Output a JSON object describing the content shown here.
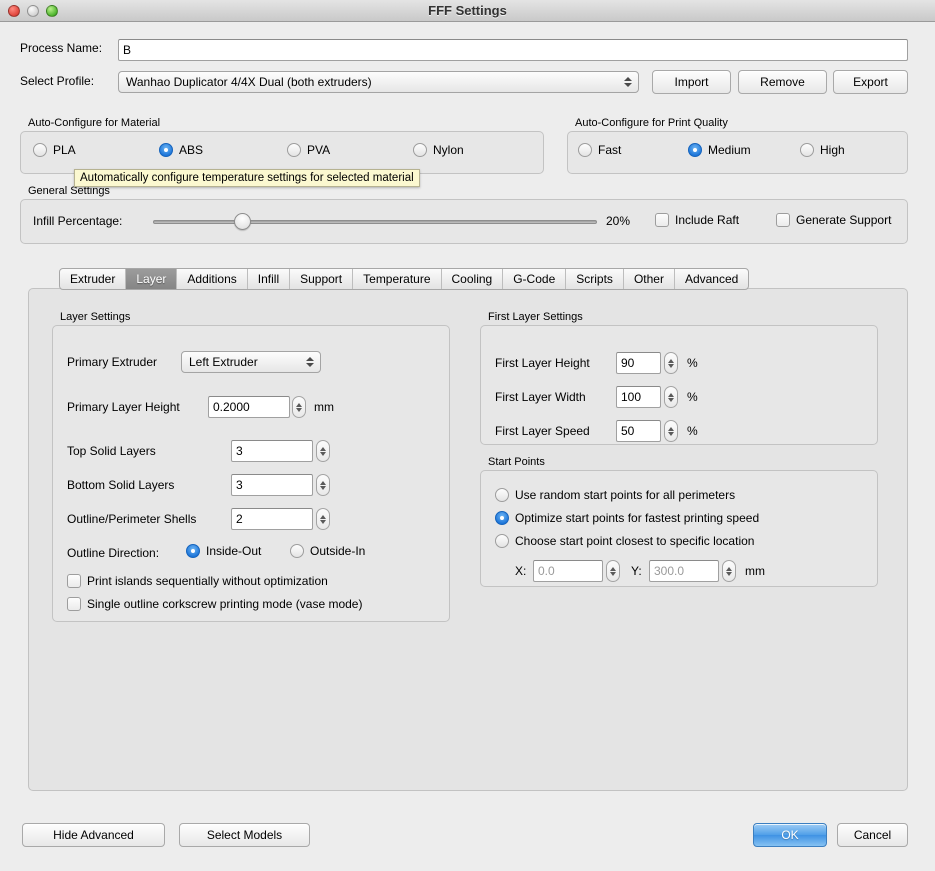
{
  "window": {
    "title": "FFF Settings",
    "controls": [
      "close-button",
      "minimize-button",
      "zoom-button"
    ]
  },
  "top": {
    "process_name_label": "Process Name:",
    "process_name_value": "B",
    "process_name_placeholder": "",
    "select_profile_label": "Select Profile:",
    "select_profile_value": "Wanhao Duplicator 4/4X Dual (both extruders)",
    "import_label": "Import",
    "remove_label": "Remove",
    "export_label": "Export"
  },
  "material": {
    "group_title": "Auto-Configure for Material",
    "options": [
      {
        "label": "PLA",
        "selected": false
      },
      {
        "label": "ABS",
        "selected": true
      },
      {
        "label": "PVA",
        "selected": false
      },
      {
        "label": "Nylon",
        "selected": false
      }
    ],
    "tooltip": "Automatically configure temperature settings for selected material"
  },
  "quality": {
    "group_title": "Auto-Configure for Print Quality",
    "options": [
      {
        "label": "Fast",
        "selected": false
      },
      {
        "label": "Medium",
        "selected": true
      },
      {
        "label": "High",
        "selected": false
      }
    ]
  },
  "general": {
    "group_title": "General Settings",
    "infill_label": "Infill Percentage:",
    "infill_value": "20%",
    "infill_percent": 20,
    "include_raft_label": "Include Raft",
    "include_raft_checked": false,
    "generate_support_label": "Generate Support",
    "generate_support_checked": false
  },
  "tabs": {
    "items": [
      {
        "label": "Extruder",
        "active": false
      },
      {
        "label": "Layer",
        "active": true
      },
      {
        "label": "Additions",
        "active": false
      },
      {
        "label": "Infill",
        "active": false
      },
      {
        "label": "Support",
        "active": false
      },
      {
        "label": "Temperature",
        "active": false
      },
      {
        "label": "Cooling",
        "active": false
      },
      {
        "label": "G-Code",
        "active": false
      },
      {
        "label": "Scripts",
        "active": false
      },
      {
        "label": "Other",
        "active": false
      },
      {
        "label": "Advanced",
        "active": false
      }
    ]
  },
  "layer_settings": {
    "group_title": "Layer Settings",
    "primary_extruder_label": "Primary Extruder",
    "primary_extruder_value": "Left Extruder",
    "primary_layer_height_label": "Primary Layer Height",
    "primary_layer_height_value": "0.2000",
    "primary_layer_height_unit": "mm",
    "top_solid_layers_label": "Top Solid Layers",
    "top_solid_layers_value": "3",
    "bottom_solid_layers_label": "Bottom Solid Layers",
    "bottom_solid_layers_value": "3",
    "outline_shells_label": "Outline/Perimeter Shells",
    "outline_shells_value": "2",
    "outline_direction_label": "Outline Direction:",
    "outline_direction_options": [
      {
        "label": "Inside-Out",
        "selected": true
      },
      {
        "label": "Outside-In",
        "selected": false
      }
    ],
    "print_islands_label": "Print islands sequentially without optimization",
    "print_islands_checked": false,
    "vase_mode_label": "Single outline corkscrew printing mode (vase mode)",
    "vase_mode_checked": false
  },
  "first_layer": {
    "group_title": "First Layer Settings",
    "height_label": "First Layer Height",
    "height_value": "90",
    "height_unit": "%",
    "width_label": "First Layer Width",
    "width_value": "100",
    "width_unit": "%",
    "speed_label": "First Layer Speed",
    "speed_value": "50",
    "speed_unit": "%"
  },
  "start_points": {
    "group_title": "Start Points",
    "options": [
      {
        "label": "Use random start points for all perimeters",
        "selected": false
      },
      {
        "label": "Optimize start points for fastest printing speed",
        "selected": true
      },
      {
        "label": "Choose start point closest to specific location",
        "selected": false
      }
    ],
    "x_label": "X:",
    "x_value": "0.0",
    "y_label": "Y:",
    "y_value": "300.0",
    "unit": "mm"
  },
  "footer": {
    "hide_advanced_label": "Hide Advanced",
    "select_models_label": "Select Models",
    "ok_label": "OK",
    "cancel_label": "Cancel"
  }
}
